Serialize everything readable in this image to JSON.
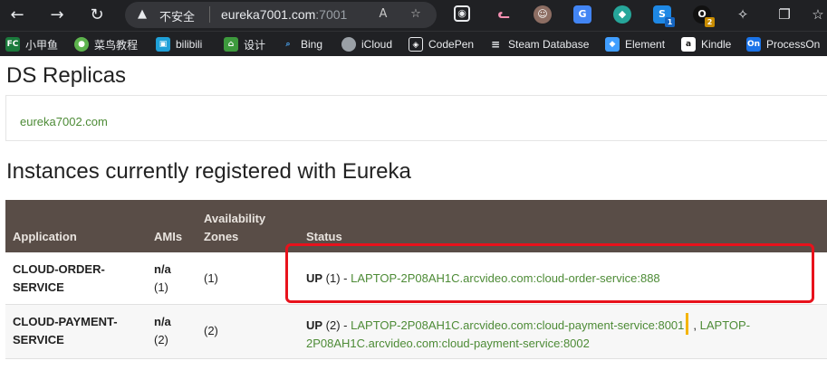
{
  "browser": {
    "security_label": "不安全",
    "url_host": "eureka7001.com",
    "url_port": ":7001",
    "extension_badges": [
      "1",
      "2"
    ],
    "bookmarks": [
      {
        "label": "小甲鱼",
        "icon": "FC",
        "color": "#1b7a3c"
      },
      {
        "label": "菜鸟教程",
        "icon": "●",
        "color": "#5db34d"
      },
      {
        "label": "bilibili",
        "icon": "▣",
        "color": "#1fa0d8"
      },
      {
        "label": "设计",
        "icon": "⌂",
        "color": "#3d9a3d"
      },
      {
        "label": "Bing",
        "icon": "⌕",
        "color": "#202124"
      },
      {
        "label": "iCloud",
        "icon": "",
        "color": "#202124"
      },
      {
        "label": "CodePen",
        "icon": "◈",
        "color": "#202124"
      },
      {
        "label": "Steam Database",
        "icon": "≡",
        "color": "#202124"
      },
      {
        "label": "Element",
        "icon": "◆",
        "color": "#409eff"
      },
      {
        "label": "Kindle",
        "icon": "a",
        "color": "#ffffff"
      },
      {
        "label": "ProcessOn",
        "icon": "On",
        "color": "#1a73e8"
      }
    ]
  },
  "page": {
    "replicas_heading": "DS Replicas",
    "replica_link": "eureka7002.com",
    "instances_heading": "Instances currently registered with Eureka",
    "table": {
      "headers": {
        "application": "Application",
        "amis": "AMIs",
        "zones_line1": "Availability",
        "zones_line2": "Zones",
        "status": "Status"
      },
      "rows": [
        {
          "app_line1": "CLOUD-ORDER-",
          "app_line2": "SERVICE",
          "amis_line1": "n/a",
          "amis_line2": "(1)",
          "zones": "(1)",
          "status_state": "UP",
          "status_count": " (1) - ",
          "link1": "LAPTOP-2P08AH1C.arcvideo.com:cloud-order-service:888"
        },
        {
          "app_line1": "CLOUD-PAYMENT-",
          "app_line2": "SERVICE",
          "amis_line1": "n/a",
          "amis_line2": "(2)",
          "zones": "(2)",
          "status_state": "UP",
          "status_count": " (2) - ",
          "link1": "LAPTOP-2P08AH1C.arcvideo.com:cloud-payment-service:8001",
          "separator": ",",
          "link2_line1": "LAPTOP-",
          "link2_line2": "2P08AH1C.arcvideo.com:cloud-payment-service:8002"
        }
      ]
    }
  },
  "colors": {
    "link": "#4d8b36",
    "table_header_bg": "#594d47",
    "highlight_border": "#e8121c",
    "caret": "#f4b400"
  }
}
